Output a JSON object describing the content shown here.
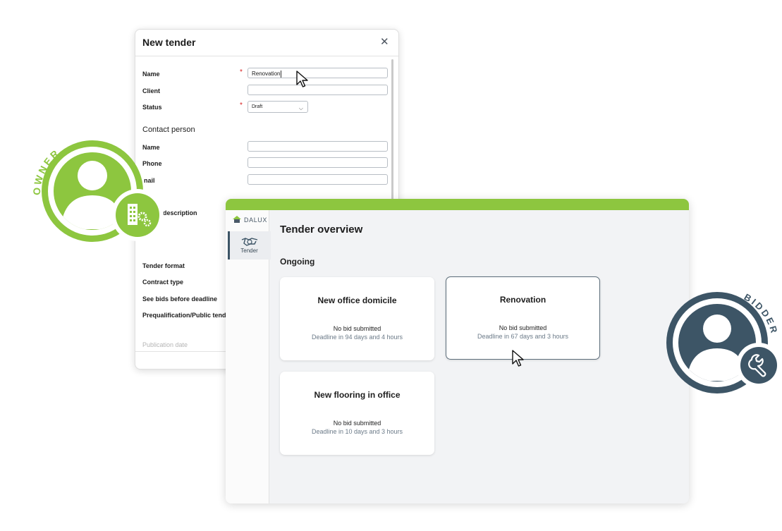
{
  "dialog": {
    "title": "New tender",
    "close_icon": "close-icon",
    "fields": {
      "name_label": "Name",
      "name_value": "Renovation",
      "client_label": "Client",
      "client_value": "",
      "status_label": "Status",
      "status_value": "Draft",
      "required_mark": "*"
    },
    "contact_section": "Contact person",
    "contact_fields": {
      "name_label": "Name",
      "phone_label": "Phone",
      "email_label_visible": "nail",
      "description_label_visible": "description"
    },
    "lower_fields": {
      "tender_format": "Tender format",
      "contract_type": "Contract type",
      "see_bids": "See bids before deadline",
      "prequalification": "Prequalification/Public tende",
      "publication_date": "Publication date"
    }
  },
  "owner_badge": {
    "text": "OWNER",
    "color": "#8dc63f",
    "icon": "building-gear-icon"
  },
  "bidder_badge": {
    "text": "BIDDER",
    "color": "#3d5566",
    "icon": "wrench-icon"
  },
  "app": {
    "logo": "DALUX",
    "accent_color": "#8dc63f",
    "nav": {
      "tender_label": "Tender",
      "icon": "handshake-icon"
    },
    "page_title": "Tender overview",
    "section_title": "Ongoing",
    "cards": [
      {
        "name": "New office domicile",
        "status": "No bid submitted",
        "deadline": "Deadline in 94 days and 4 hours"
      },
      {
        "name": "Renovation",
        "status": "No bid submitted",
        "deadline": "Deadline in 67 days and 3 hours"
      },
      {
        "name": "New flooring in office",
        "status": "No bid submitted",
        "deadline": "Deadline in 10 days and 3 hours"
      }
    ]
  }
}
